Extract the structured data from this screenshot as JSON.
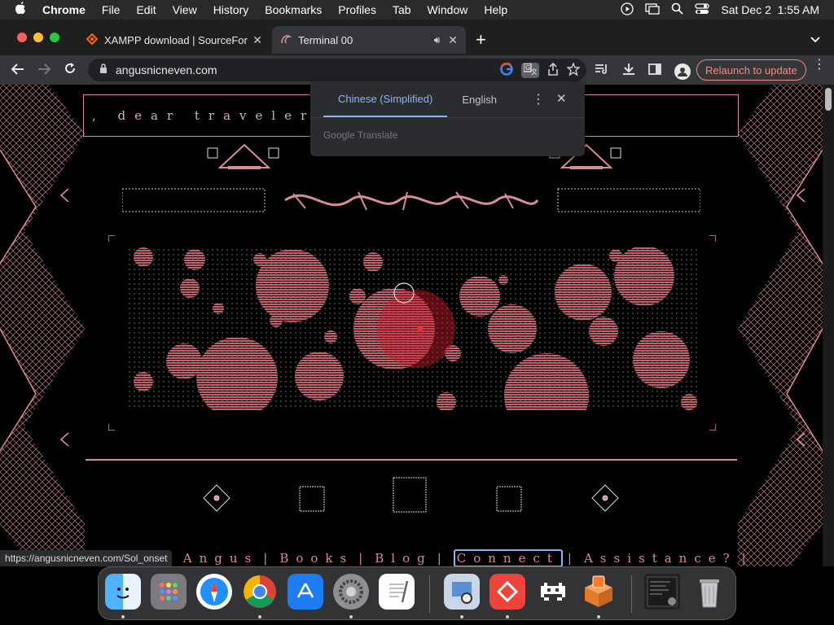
{
  "menubar": {
    "apple_icon": "apple-logo",
    "app_name": "Chrome",
    "items": [
      "File",
      "Edit",
      "View",
      "History",
      "Bookmarks",
      "Profiles",
      "Tab",
      "Window",
      "Help"
    ],
    "datetime": "Sat Dec 2  1:55 AM"
  },
  "tabs": [
    {
      "title": "XAMPP download | SourceForg",
      "icon": "sourceforge-icon",
      "active": false
    },
    {
      "title": "Terminal 00",
      "icon": "site-icon",
      "active": true,
      "audio": true
    }
  ],
  "toolbar": {
    "url": "angusnicneven.com",
    "relaunch_label": "Relaunch to update"
  },
  "page": {
    "header_text": ", dear traveler.",
    "footer_nav": [
      "t Angus",
      "Books",
      "Blog",
      "Connect",
      "Assistance?"
    ],
    "highlighted_nav_index": 3
  },
  "translate_popup": {
    "tab_source": "Chinese (Simplified)",
    "tab_target": "English",
    "footer": "Google Translate"
  },
  "status_bar": {
    "url": "https://angusnicneven.com/Sol_onset"
  },
  "dock": {
    "apps": [
      {
        "name": "Finder",
        "icon": "finder-icon",
        "running": true
      },
      {
        "name": "Launchpad",
        "icon": "launchpad-icon",
        "running": false
      },
      {
        "name": "Safari",
        "icon": "safari-icon",
        "running": false
      },
      {
        "name": "Chrome",
        "icon": "chrome-icon",
        "running": true
      },
      {
        "name": "App Store",
        "icon": "appstore-icon",
        "running": false
      },
      {
        "name": "System Settings",
        "icon": "settings-icon",
        "running": true
      },
      {
        "name": "TextEdit",
        "icon": "textedit-icon",
        "running": false
      },
      {
        "name": "Preview",
        "icon": "preview-icon",
        "running": true
      },
      {
        "name": "AnyDesk",
        "icon": "anydesk-icon",
        "running": true
      },
      {
        "name": "Game",
        "icon": "invader-icon",
        "running": false
      },
      {
        "name": "XAMPP",
        "icon": "xampp-icon",
        "running": true
      },
      {
        "name": "Window",
        "icon": "window-thumbnail-icon",
        "running": false
      },
      {
        "name": "Trash",
        "icon": "trash-icon",
        "running": false
      }
    ]
  },
  "colors": {
    "accent_pink": "#d98c95",
    "translate_blue": "#8ab4f8",
    "relaunch_red": "#f28b82"
  }
}
